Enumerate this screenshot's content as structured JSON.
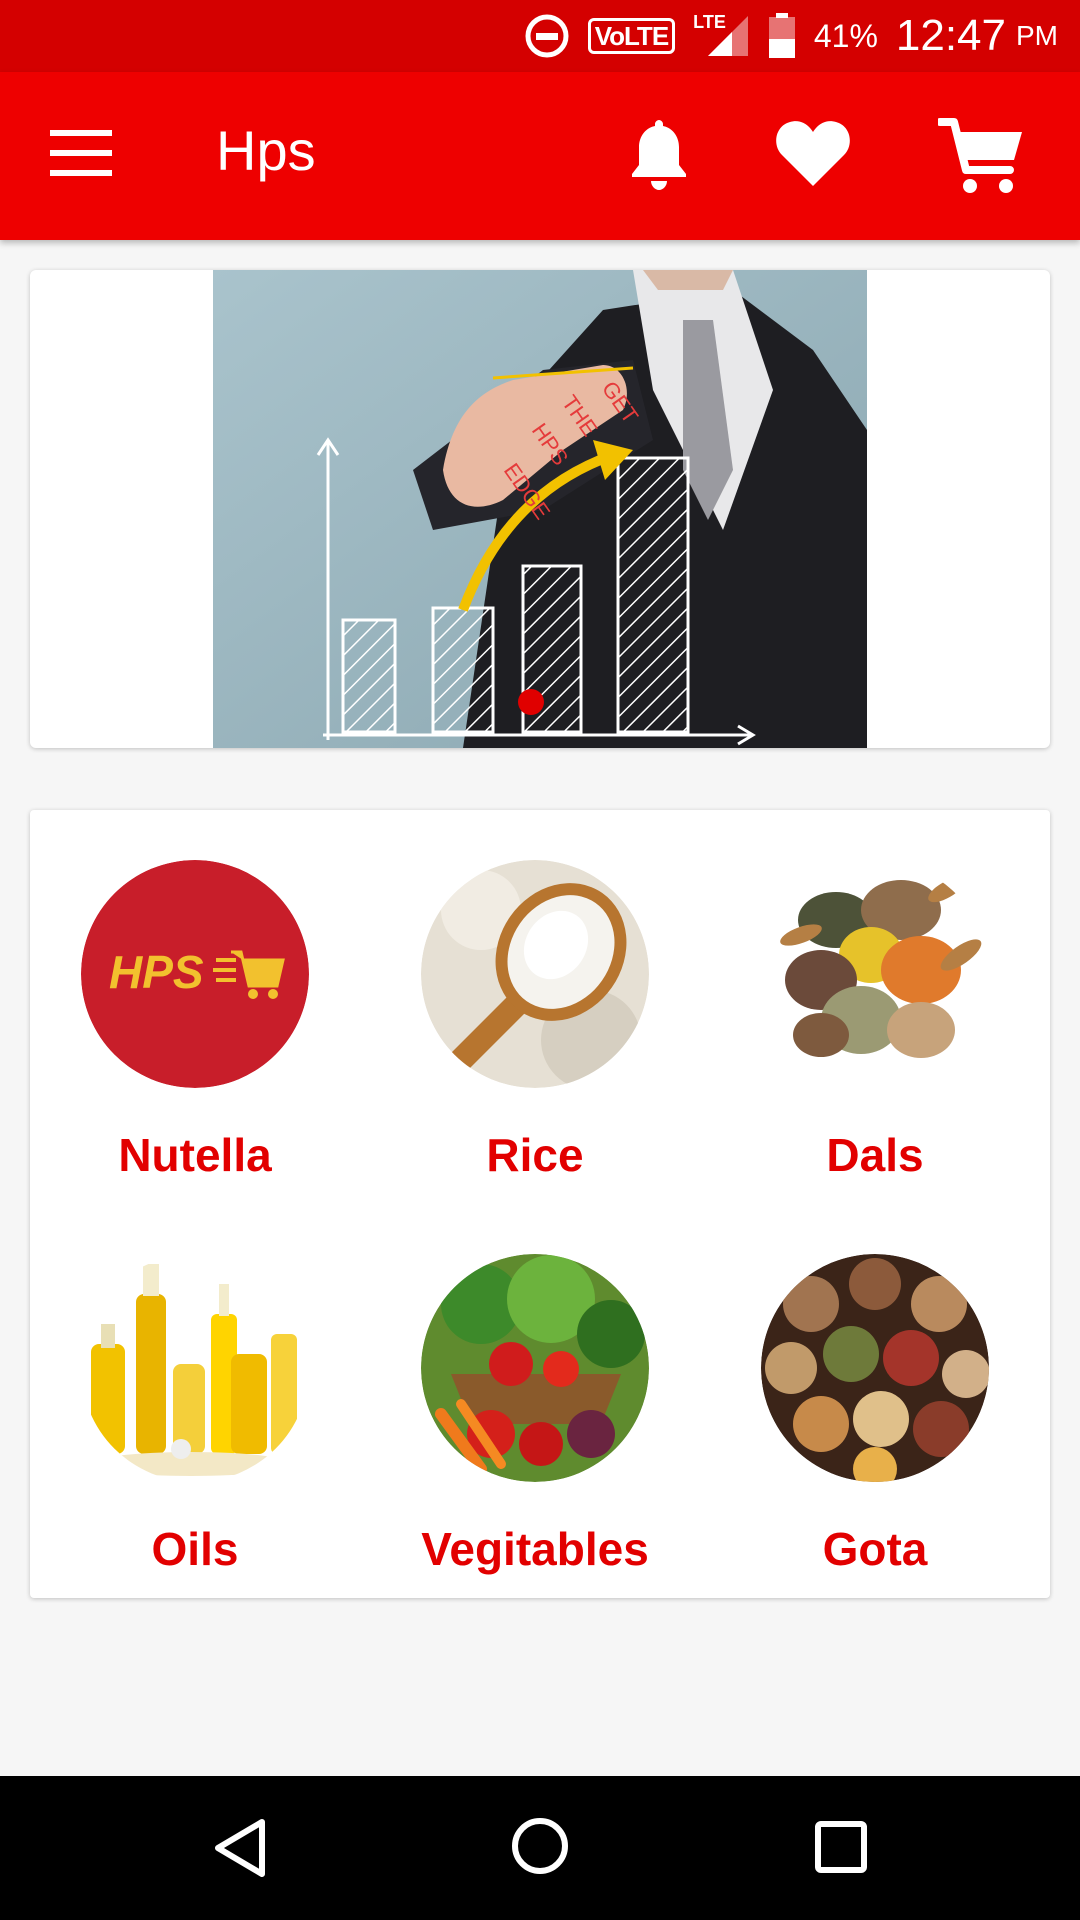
{
  "status_bar": {
    "volte": "VoLTE",
    "lte": "LTE",
    "battery_percent": "41%",
    "time": "12:47",
    "ampm": "PM"
  },
  "app_bar": {
    "title": "Hps"
  },
  "banner": {
    "finger_text": [
      "GET",
      "THE",
      "HPS",
      "EDGE"
    ]
  },
  "categories": [
    {
      "label": "Nutella",
      "logo_text": "HPS"
    },
    {
      "label": "Rice"
    },
    {
      "label": "Dals"
    },
    {
      "label": "Oils"
    },
    {
      "label": "Vegitables"
    },
    {
      "label": "Gota"
    }
  ],
  "colors": {
    "status_bar": "#d40000",
    "app_bar": "#ee0000",
    "label": "#e20000",
    "background": "#f6f6f6"
  }
}
